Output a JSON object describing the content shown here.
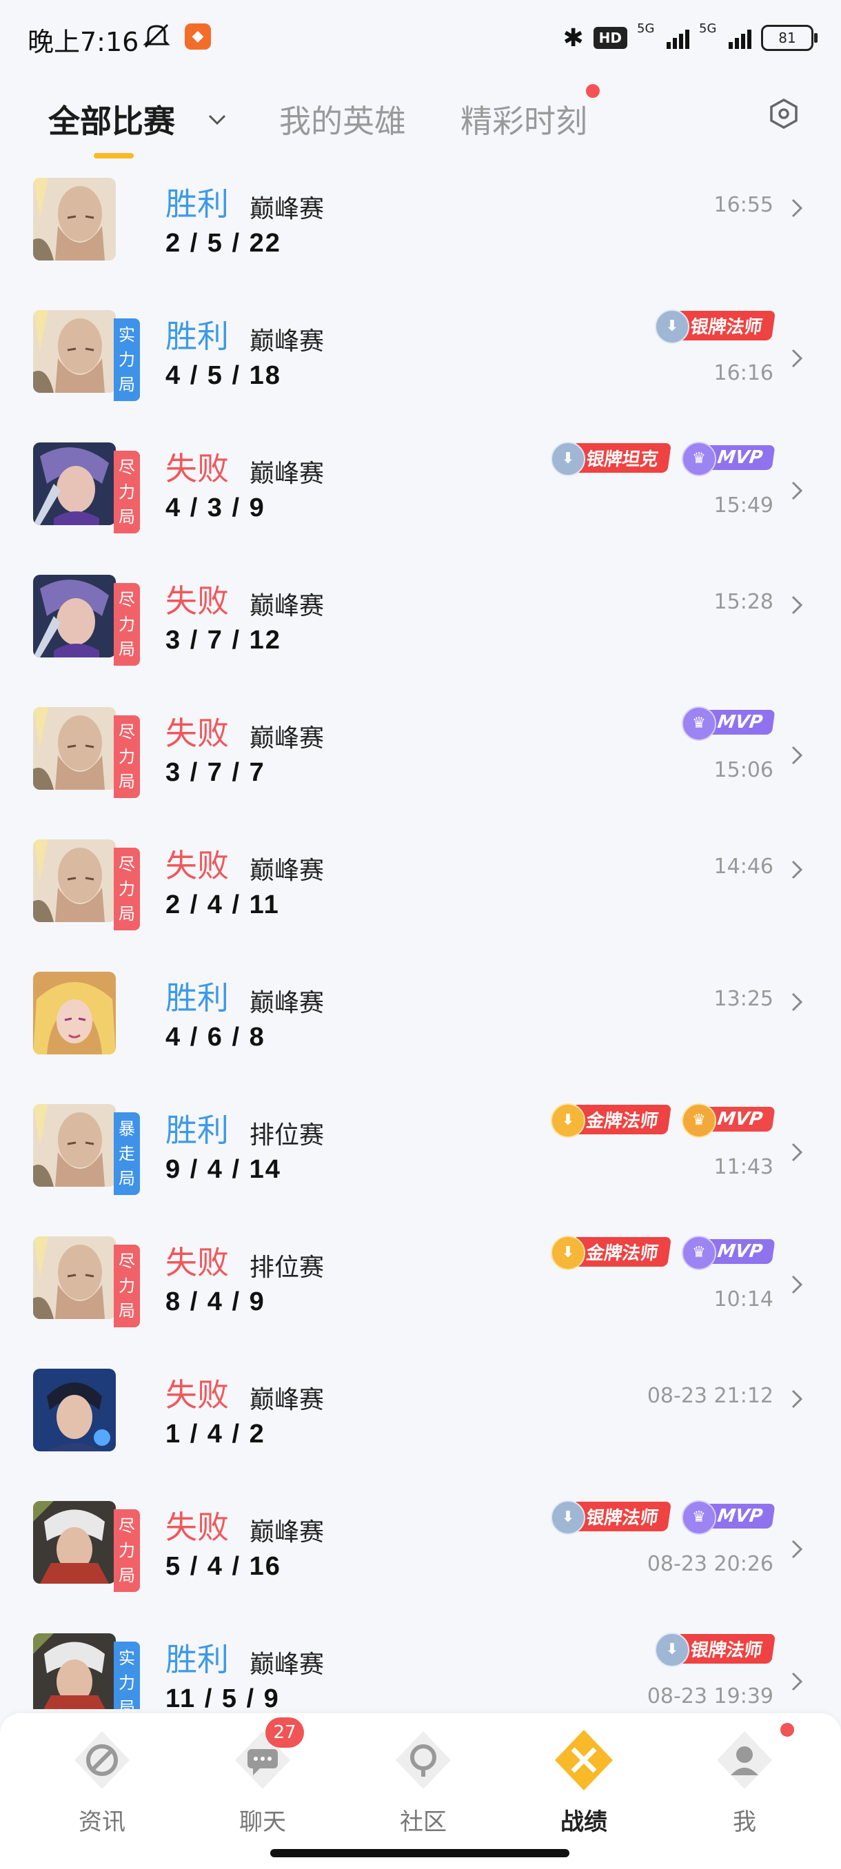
{
  "status_bar": {
    "time": "晚上7:16",
    "hd": "HD",
    "net1": "5G",
    "net2": "5G",
    "battery": "81"
  },
  "tabs": {
    "all_matches": "全部比赛",
    "my_heroes": "我的英雄",
    "highlights": "精彩时刻"
  },
  "colors": {
    "win": "#3d9ae6",
    "lose": "#f0575b",
    "accent": "#f9b928",
    "mvp": "#8f72ee"
  },
  "matches": [
    {
      "hero_icon": "bald-monk-portrait",
      "mode": "",
      "result": "胜利",
      "type": "巅峰赛",
      "kda": "2 / 5 / 22",
      "time": "16:55",
      "badges": []
    },
    {
      "hero_icon": "bald-monk-portrait",
      "mode": "实力局",
      "result": "胜利",
      "type": "巅峰赛",
      "kda": "4 / 5 / 18",
      "time": "16:16",
      "badges": [
        {
          "kind": "silver",
          "text": "银牌法师"
        }
      ]
    },
    {
      "hero_icon": "purple-hair-portrait",
      "mode": "尽力局",
      "result": "失败",
      "type": "巅峰赛",
      "kda": "4 / 3 / 9",
      "time": "15:49",
      "badges": [
        {
          "kind": "silver",
          "text": "银牌坦克"
        },
        {
          "kind": "mvp",
          "text": "MVP"
        }
      ]
    },
    {
      "hero_icon": "purple-hair-portrait",
      "mode": "尽力局",
      "result": "失败",
      "type": "巅峰赛",
      "kda": "3 / 7 / 12",
      "time": "15:28",
      "badges": []
    },
    {
      "hero_icon": "bald-monk-portrait",
      "mode": "尽力局",
      "result": "失败",
      "type": "巅峰赛",
      "kda": "3 / 7 / 7",
      "time": "15:06",
      "badges": [
        {
          "kind": "mvp",
          "text": "MVP"
        }
      ]
    },
    {
      "hero_icon": "bald-monk-portrait",
      "mode": "尽力局",
      "result": "失败",
      "type": "巅峰赛",
      "kda": "2 / 4 / 11",
      "time": "14:46",
      "badges": []
    },
    {
      "hero_icon": "blonde-elf-portrait",
      "mode": "",
      "result": "胜利",
      "type": "巅峰赛",
      "kda": "4 / 6 / 8",
      "time": "13:25",
      "badges": []
    },
    {
      "hero_icon": "bald-monk-portrait",
      "mode": "暴走局",
      "result": "胜利",
      "type": "排位赛",
      "kda": "9 / 4 / 14",
      "time": "11:43",
      "badges": [
        {
          "kind": "gold",
          "text": "金牌法师"
        },
        {
          "kind": "gmvp",
          "text": "MVP"
        }
      ]
    },
    {
      "hero_icon": "bald-monk-portrait",
      "mode": "尽力局",
      "result": "失败",
      "type": "排位赛",
      "kda": "8 / 4 / 9",
      "time": "10:14",
      "badges": [
        {
          "kind": "gold",
          "text": "金牌法师"
        },
        {
          "kind": "mvp",
          "text": "MVP"
        }
      ]
    },
    {
      "hero_icon": "dark-hair-portrait",
      "mode": "",
      "result": "失败",
      "type": "巅峰赛",
      "kda": "1 / 4 / 2",
      "time": "08-23 21:12",
      "badges": []
    },
    {
      "hero_icon": "white-hair-portrait",
      "mode": "尽力局",
      "result": "失败",
      "type": "巅峰赛",
      "kda": "5 / 4 / 16",
      "time": "08-23 20:26",
      "badges": [
        {
          "kind": "silver",
          "text": "银牌法师"
        },
        {
          "kind": "mvp",
          "text": "MVP"
        }
      ]
    },
    {
      "hero_icon": "white-hair-portrait",
      "mode": "实力局",
      "result": "胜利",
      "type": "巅峰赛",
      "kda": "11 / 5 / 9",
      "time": "08-23 19:39",
      "badges": [
        {
          "kind": "silver",
          "text": "银牌法师"
        }
      ]
    }
  ],
  "bottom_nav": [
    {
      "label": "资讯",
      "icon": "news-icon"
    },
    {
      "label": "聊天",
      "icon": "chat-icon",
      "badge": "27"
    },
    {
      "label": "社区",
      "icon": "community-icon"
    },
    {
      "label": "战绩",
      "icon": "records-icon",
      "active": true
    },
    {
      "label": "我",
      "icon": "profile-icon",
      "dot": true
    }
  ]
}
